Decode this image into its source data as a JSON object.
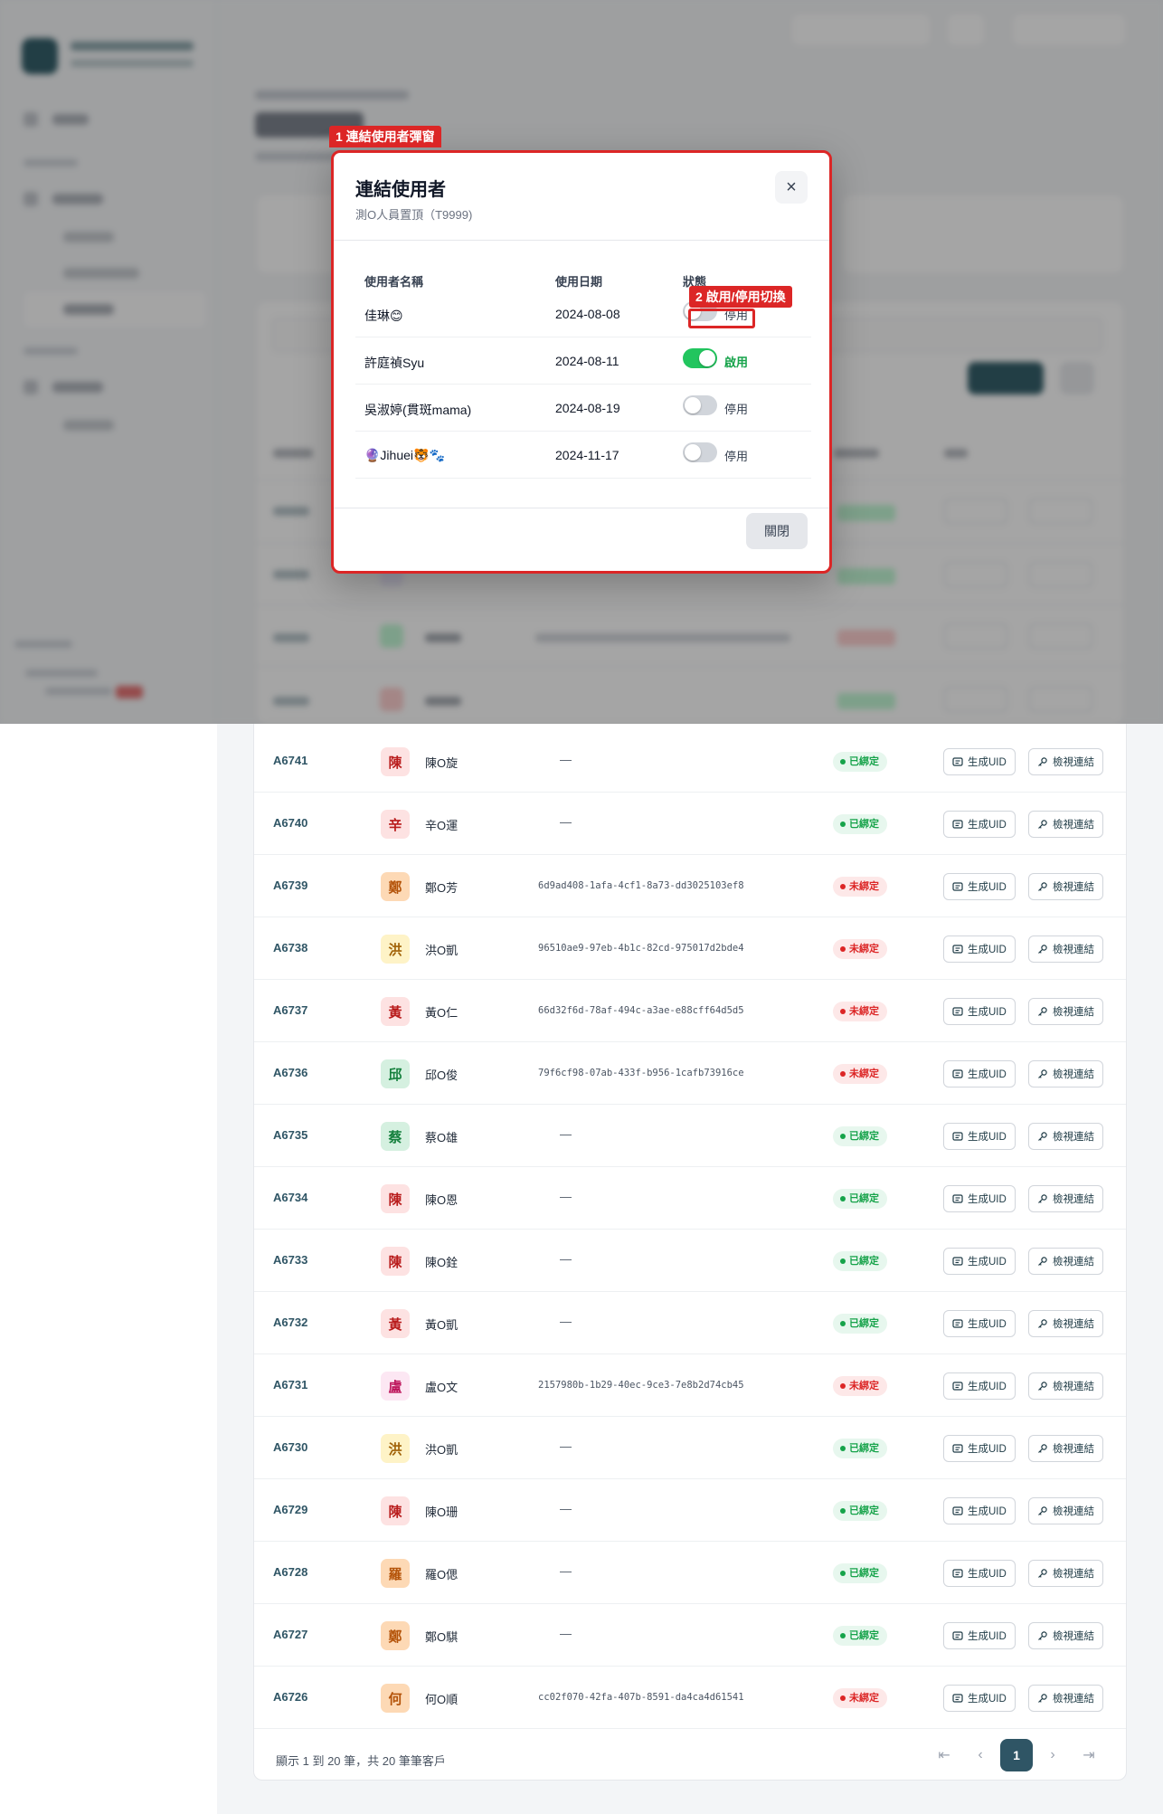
{
  "annotations": {
    "tag1": "1 連結使用者彈窗",
    "tag2": "2 啟用/停用切換"
  },
  "modal": {
    "title": "連結使用者",
    "subtitle": "測O人員置頂（T9999)",
    "headers": {
      "name": "使用者名稱",
      "date": "使用日期",
      "status": "狀態"
    },
    "users": [
      {
        "name": "佳琳😊",
        "date": "2024-08-08",
        "enabled": false,
        "status": "停用"
      },
      {
        "name": "許庭禎Syu",
        "date": "2024-08-11",
        "enabled": true,
        "status": "啟用"
      },
      {
        "name": "吳淑婷(貫斑mama)",
        "date": "2024-08-19",
        "enabled": false,
        "status": "停用"
      },
      {
        "name": "🔮Jihuei🐯🐾",
        "date": "2024-11-17",
        "enabled": false,
        "status": "停用"
      }
    ],
    "close_label": "關閉",
    "close_icon": "×"
  },
  "table": {
    "gen_label": "生成UID",
    "view_label": "檢視連結",
    "bound_label": "已綁定",
    "unbound_label": "未綁定",
    "empty_uid": "—",
    "rows": [
      {
        "id": "A6741",
        "initial": "陳",
        "name": "陳O旋",
        "uid": "",
        "bound": true,
        "color": "red"
      },
      {
        "id": "A6740",
        "initial": "辛",
        "name": "辛O運",
        "uid": "",
        "bound": true,
        "color": "red"
      },
      {
        "id": "A6739",
        "initial": "鄭",
        "name": "鄭O芳",
        "uid": "6d9ad408-1afa-4cf1-8a73-dd3025103ef8",
        "bound": false,
        "color": "orange"
      },
      {
        "id": "A6738",
        "initial": "洪",
        "name": "洪O凱",
        "uid": "96510ae9-97eb-4b1c-82cd-975017d2bde4",
        "bound": false,
        "color": "yellow"
      },
      {
        "id": "A6737",
        "initial": "黃",
        "name": "黃O仁",
        "uid": "66d32f6d-78af-494c-a3ae-e88cff64d5d5",
        "bound": false,
        "color": "red"
      },
      {
        "id": "A6736",
        "initial": "邱",
        "name": "邱O俊",
        "uid": "79f6cf98-07ab-433f-b956-1cafb73916ce",
        "bound": false,
        "color": "green"
      },
      {
        "id": "A6735",
        "initial": "蔡",
        "name": "蔡O雄",
        "uid": "",
        "bound": true,
        "color": "green"
      },
      {
        "id": "A6734",
        "initial": "陳",
        "name": "陳O恩",
        "uid": "",
        "bound": true,
        "color": "red"
      },
      {
        "id": "A6733",
        "initial": "陳",
        "name": "陳O銓",
        "uid": "",
        "bound": true,
        "color": "red"
      },
      {
        "id": "A6732",
        "initial": "黃",
        "name": "黃O凱",
        "uid": "",
        "bound": true,
        "color": "red"
      },
      {
        "id": "A6731",
        "initial": "盧",
        "name": "盧O文",
        "uid": "2157980b-1b29-40ec-9ce3-7e8b2d74cb45",
        "bound": false,
        "color": "pink"
      },
      {
        "id": "A6730",
        "initial": "洪",
        "name": "洪O凱",
        "uid": "",
        "bound": true,
        "color": "yellow"
      },
      {
        "id": "A6729",
        "initial": "陳",
        "name": "陳O珊",
        "uid": "",
        "bound": true,
        "color": "red"
      },
      {
        "id": "A6728",
        "initial": "羅",
        "name": "羅O偲",
        "uid": "",
        "bound": true,
        "color": "orange"
      },
      {
        "id": "A6727",
        "initial": "鄭",
        "name": "鄭O騏",
        "uid": "",
        "bound": true,
        "color": "orange"
      },
      {
        "id": "A6726",
        "initial": "何",
        "name": "何O順",
        "uid": "cc02f070-42fa-407b-8591-da4ca4d61541",
        "bound": false,
        "color": "orange"
      }
    ]
  },
  "pagination": {
    "summary": "顯示 1 到 20 筆，共 20 筆筆客戶",
    "current_page": "1",
    "first_icon": "⇤",
    "prev_icon": "‹",
    "next_icon": "›",
    "last_icon": "⇥"
  },
  "colors": {
    "brand": "#2f5565",
    "annotation": "#dc2626",
    "bound_fg": "#16a34a",
    "unbound_fg": "#dc2626",
    "toggle_on": "#22c55e",
    "avatar": {
      "red": [
        "#fde2e2",
        "#b91c1c"
      ],
      "orange": [
        "#fdd9b5",
        "#b45309"
      ],
      "yellow": [
        "#fef3c7",
        "#a16207"
      ],
      "green": [
        "#d5f0e0",
        "#15803d"
      ],
      "pink": [
        "#fce7f3",
        "#be185d"
      ]
    }
  }
}
